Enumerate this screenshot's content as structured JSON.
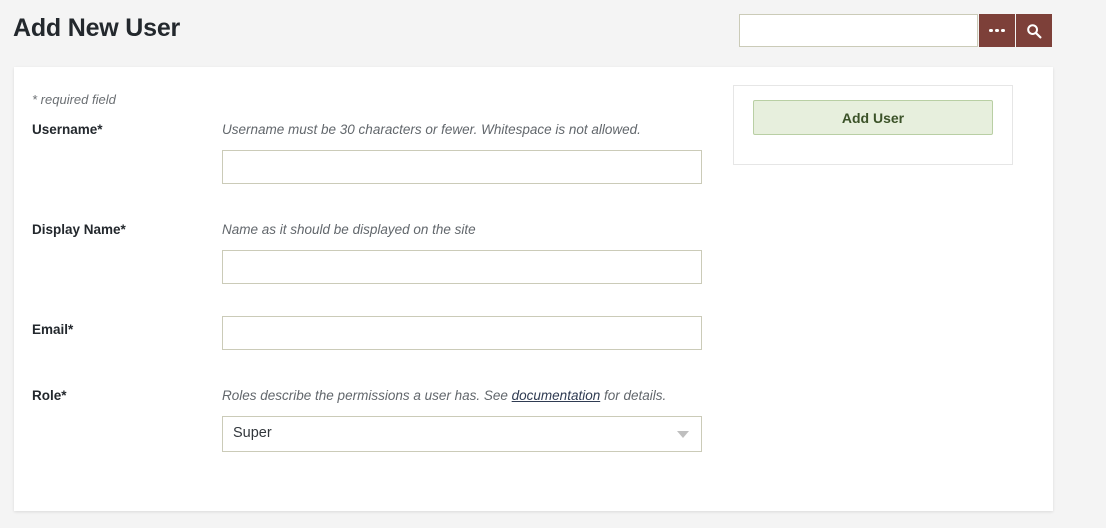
{
  "header": {
    "title": "Add New User"
  },
  "search": {
    "value": "",
    "placeholder": "",
    "more_label": "",
    "search_label": "",
    "button_color": "#7d4039"
  },
  "card": {
    "required_note": "* required field"
  },
  "form": {
    "fields": [
      {
        "label": "Username*",
        "help": "Username must be 30 characters or fewer. Whitespace is not allowed.",
        "value": "",
        "placeholder": ""
      },
      {
        "label": "Display Name*",
        "help": "Name as it should be displayed on the site",
        "value": "",
        "placeholder": ""
      },
      {
        "label": "Email*",
        "help": "",
        "value": "",
        "placeholder": ""
      },
      {
        "label": "Role*",
        "help_before": "Roles describe the permissions a user has. See ",
        "help_link": "documentation",
        "help_after": " for details.",
        "value": "Super",
        "options": [
          "Super"
        ]
      }
    ]
  },
  "side_panel": {
    "add_user_label": "Add User",
    "button_fill": "#e7efdd",
    "button_border": "#b9cfa4",
    "button_text_color": "#3b5228"
  }
}
